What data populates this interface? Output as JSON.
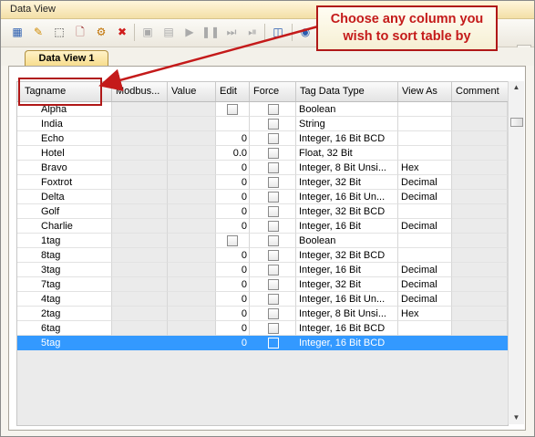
{
  "window": {
    "title": "Data View"
  },
  "tab": {
    "label": "Data View 1"
  },
  "callout": {
    "text": "Choose any column you wish to sort table by"
  },
  "columns": {
    "tagname": "Tagname",
    "modbus": "Modbus...",
    "value": "Value",
    "edit": "Edit",
    "force": "Force",
    "type": "Tag Data Type",
    "view": "View As",
    "comment": "Comment"
  },
  "rows": [
    {
      "name": "Alpha",
      "edit": "",
      "edit_checkbox": true,
      "type": "Boolean",
      "view": ""
    },
    {
      "name": "India",
      "edit": "",
      "edit_checkbox": false,
      "type": "String",
      "view": ""
    },
    {
      "name": "Echo",
      "edit": "0",
      "edit_checkbox": false,
      "type": "Integer, 16 Bit BCD",
      "view": ""
    },
    {
      "name": "Hotel",
      "edit": "0.0",
      "edit_checkbox": false,
      "type": "Float, 32 Bit",
      "view": ""
    },
    {
      "name": "Bravo",
      "edit": "0",
      "edit_checkbox": false,
      "type": "Integer, 8 Bit Unsi...",
      "view": "Hex"
    },
    {
      "name": "Foxtrot",
      "edit": "0",
      "edit_checkbox": false,
      "type": "Integer, 32 Bit",
      "view": "Decimal"
    },
    {
      "name": "Delta",
      "edit": "0",
      "edit_checkbox": false,
      "type": "Integer, 16 Bit Un...",
      "view": "Decimal"
    },
    {
      "name": "Golf",
      "edit": "0",
      "edit_checkbox": false,
      "type": "Integer, 32 Bit BCD",
      "view": ""
    },
    {
      "name": "Charlie",
      "edit": "0",
      "edit_checkbox": false,
      "type": "Integer, 16 Bit",
      "view": "Decimal"
    },
    {
      "name": "1tag",
      "edit": "",
      "edit_checkbox": true,
      "type": "Boolean",
      "view": ""
    },
    {
      "name": "8tag",
      "edit": "0",
      "edit_checkbox": false,
      "type": "Integer, 32 Bit BCD",
      "view": ""
    },
    {
      "name": "3tag",
      "edit": "0",
      "edit_checkbox": false,
      "type": "Integer, 16 Bit",
      "view": "Decimal"
    },
    {
      "name": "7tag",
      "edit": "0",
      "edit_checkbox": false,
      "type": "Integer, 32 Bit",
      "view": "Decimal"
    },
    {
      "name": "4tag",
      "edit": "0",
      "edit_checkbox": false,
      "type": "Integer, 16 Bit Un...",
      "view": "Decimal"
    },
    {
      "name": "2tag",
      "edit": "0",
      "edit_checkbox": false,
      "type": "Integer, 8 Bit Unsi...",
      "view": "Hex"
    },
    {
      "name": "6tag",
      "edit": "0",
      "edit_checkbox": false,
      "type": "Integer, 16 Bit BCD",
      "view": ""
    },
    {
      "name": "5tag",
      "edit": "0",
      "edit_checkbox": false,
      "type": "Integer, 16 Bit BCD",
      "view": "",
      "selected": true
    }
  ],
  "toolbar_icons": [
    "table-icon",
    "edit-tag-icon",
    "select-icon",
    "delete-page-icon",
    "clear-icon",
    "stop-red-icon",
    "nav-icon",
    "save-icon",
    "play-icon",
    "pause-icon",
    "step-icon",
    "skip-icon",
    "options-icon",
    "help-icon"
  ],
  "colors": {
    "accent": "#b01818",
    "selection": "#3399ff",
    "tab": "#f7dc8a"
  }
}
